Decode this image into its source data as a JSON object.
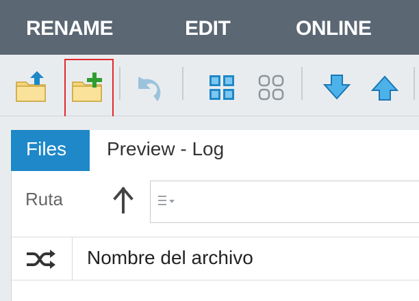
{
  "menu": {
    "items": [
      "RENAME",
      "EDIT",
      "ONLINE"
    ]
  },
  "toolbar": {
    "buttons": [
      "folder-up-icon",
      "folder-add-icon",
      "undo-icon",
      "select-all-icon",
      "select-none-icon",
      "move-down-icon",
      "move-up-icon"
    ],
    "highlighted": "folder-add-icon"
  },
  "tabs": {
    "active": "Files",
    "inactive": "Preview - Log"
  },
  "path": {
    "label": "Ruta",
    "value": ""
  },
  "table": {
    "columns": [
      "Nombre del archivo"
    ]
  },
  "colors": {
    "menubar": "#5b6773",
    "accent": "#1e88c8",
    "highlight": "#e0282d",
    "folder": "#f6d57a",
    "plus": "#2f9e2f",
    "arrow_blue": "#3aa8e6"
  }
}
